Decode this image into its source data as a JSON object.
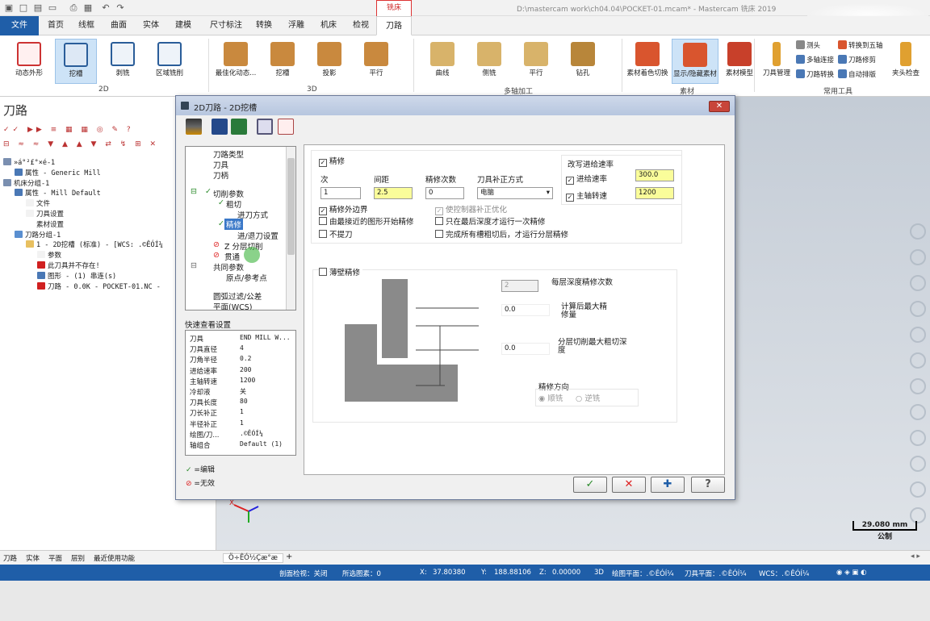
{
  "window": {
    "title": "D:\\mastercam work\\ch04.04\\POCKET-01.mcam* - Mastercam 铣床 2019",
    "context_tab": "铣床"
  },
  "menu": {
    "tabs": [
      "文件",
      "首页",
      "线框",
      "曲面",
      "实体",
      "建模",
      "尺寸标注",
      "转换",
      "浮雕",
      "机床",
      "检视",
      "刀路"
    ]
  },
  "ribbon": {
    "btns_2d": [
      "动态外形",
      "挖槽",
      "剥铣",
      "区域铣削"
    ],
    "group_2d": "2D",
    "btns_3d": [
      "最佳化动态...",
      "挖槽",
      "投影",
      "平行"
    ],
    "group_3d": "3D",
    "btns_multi": [
      "曲线",
      "侧铣",
      "平行",
      "钻孔"
    ],
    "group_multi": "多轴加工",
    "btns_stock": [
      "素材着色切换",
      "显示/隐藏素材",
      "素材模型"
    ],
    "group_stock": "素材",
    "btns_util": [
      "刀具管理",
      "夹头检查"
    ],
    "util_small": [
      "测头",
      "转换到五轴",
      "多轴连接",
      "刀路修剪",
      "刀路转换",
      "自动排版"
    ],
    "group_util": "常用工具"
  },
  "manager": {
    "title": "刀路",
    "tree": [
      {
        "indent": 0,
        "text": "»á°²£°×é-1",
        "icon": "#7a8fb0"
      },
      {
        "indent": 1,
        "text": "属性 - Generic Mill",
        "icon": "#4a78b5"
      },
      {
        "indent": 0,
        "text": "机床分组-1",
        "icon": "#7a8fb0"
      },
      {
        "indent": 1,
        "text": "属性 - Mill Default",
        "icon": "#4a78b5"
      },
      {
        "indent": 2,
        "text": "文件",
        "icon": "#f2f2f2"
      },
      {
        "indent": 2,
        "text": "刀具设置",
        "icon": "#f2f2f2"
      },
      {
        "indent": 2,
        "text": "素材设置",
        "icon": "#ffffff"
      },
      {
        "indent": 1,
        "text": "刀路分组-1",
        "icon": "#5a8fd0"
      },
      {
        "indent": 2,
        "text": "1 - 2D挖槽 (标准) - [WCS: .©ÊÓÍ¼",
        "icon": "#e8c060"
      },
      {
        "indent": 3,
        "text": "参数",
        "icon": "#f2f2f2"
      },
      {
        "indent": 3,
        "text": "此刀具并不存在!",
        "icon": "#d02020"
      },
      {
        "indent": 3,
        "text": "图形 - (1) 串连(s)",
        "icon": "#4a78b5"
      },
      {
        "indent": 3,
        "text": "刀路 - 0.0K - POCKET-01.NC -",
        "icon": "#d02020"
      }
    ],
    "bottom_tabs": [
      "刀路",
      "实体",
      "平面",
      "层别",
      "最近使用功能"
    ]
  },
  "graphics": {
    "tab": "Ö÷ÊÓ½Çæ°æ",
    "add_tab": "+",
    "scale_value": "29.080 mm",
    "scale_unit": "公制"
  },
  "status": {
    "section_view": "剖面检视：关闭",
    "selected": "所选图素：0",
    "x_label": "X:",
    "x": "37.80380",
    "y_label": "Y:",
    "y": "188.88106",
    "z_label": "Z:",
    "z": "0.00000",
    "mode": "3D",
    "plane_draw": "绘图平面：.©ÊÓÍ¼",
    "plane_tool": "刀具平面：.©ÊÓÍ¼",
    "wcs": "WCS：.©ÊÓÍ¼"
  },
  "dialog": {
    "title": "2D刀路 - 2D挖槽",
    "param_tree": [
      "刀路类型",
      "刀具",
      "刀柄",
      "切削参数",
      "粗切",
      "进刀方式",
      "精修",
      "进/退刀设置",
      "Z 分层切削",
      "贯通",
      "共同参数",
      "原点/参考点",
      "圆弧过滤/公差",
      "平面(WCS)"
    ],
    "quick_title": "快速查看设置",
    "quick": [
      {
        "k": "刀具",
        "v": "END MILL W..."
      },
      {
        "k": "刀具直径",
        "v": "4"
      },
      {
        "k": "刀角半径",
        "v": "0.2"
      },
      {
        "k": "进给速率",
        "v": "200"
      },
      {
        "k": "主轴转速",
        "v": "1200"
      },
      {
        "k": "冷却液",
        "v": "关"
      },
      {
        "k": "刀具长度",
        "v": "80"
      },
      {
        "k": "刀长补正",
        "v": "1"
      },
      {
        "k": "半径补正",
        "v": "1"
      },
      {
        "k": "绘图/刀...",
        "v": ".©ÊÓÍ¼"
      },
      {
        "k": "轴组合",
        "v": "Default (1)"
      }
    ],
    "legend_edit": "=编辑",
    "legend_invalid": "=无效",
    "finish": {
      "enable": "精修",
      "col_pass": "次",
      "col_spacing": "间距",
      "col_spring": "精修次数",
      "col_comp": "刀具补正方式",
      "pass": "1",
      "spacing": "2.5",
      "spring": "0",
      "comp": "电脑",
      "override": "改写进给速率",
      "feed_label": "进给速率",
      "feed": "300.0",
      "spindle_label": "主轴转速",
      "spindle": "1200",
      "opt_outer": "精修外边界",
      "opt_nearest": "由最接近的图形开始精修",
      "opt_noretract": "不提刀",
      "opt_ctrl": "使控制器补正优化",
      "opt_depth": "只在最后深度才运行一次精修",
      "opt_all": "完成所有槽粗切后，才运行分层精修"
    },
    "thinwall": {
      "enable": "薄壁精修",
      "depth_passes_label": "每层深度精修次数",
      "depth_passes": "2",
      "after_label": "计算后最大精修量",
      "after": "0.0",
      "layer_label": "分层切削最大粗切深度",
      "layer": "0.0",
      "dir_label": "精修方向",
      "climb": "顺铣",
      "conv": "逆铣"
    }
  }
}
